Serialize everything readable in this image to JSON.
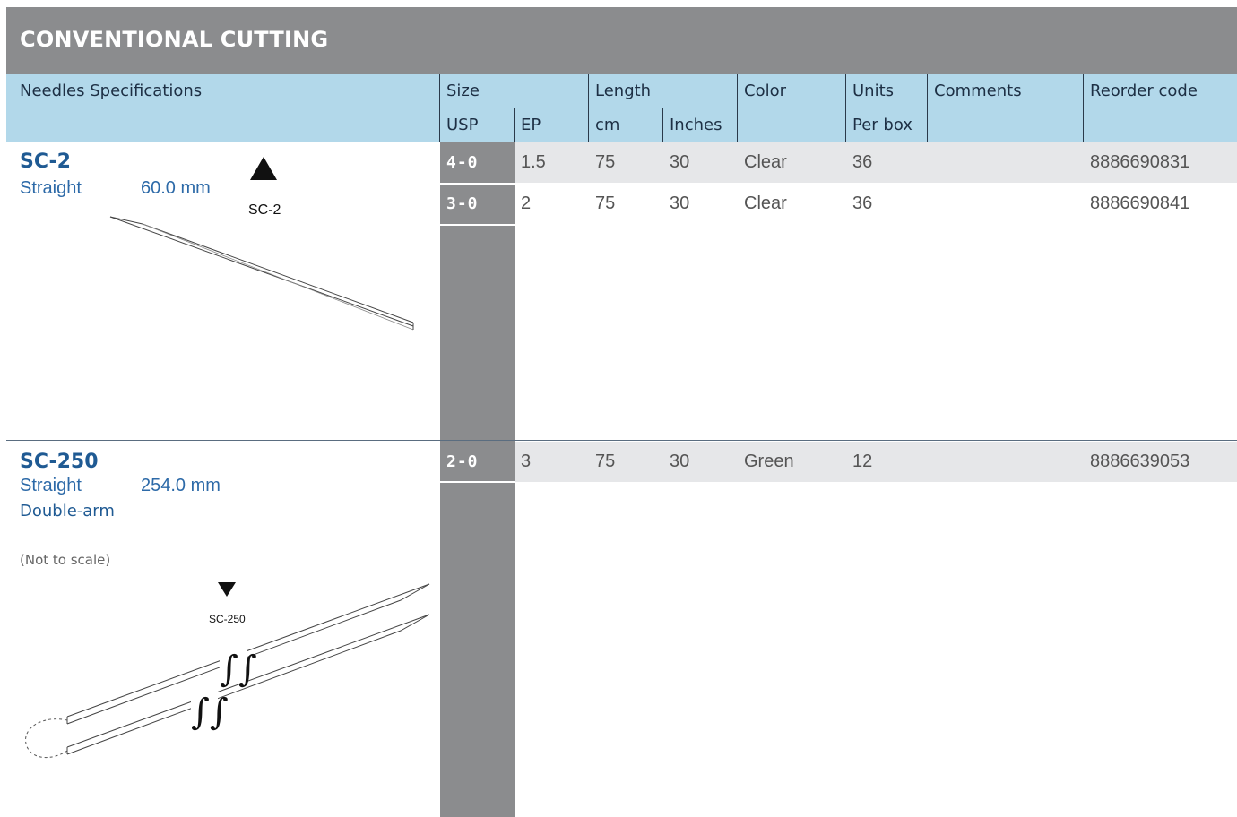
{
  "title": "CONVENTIONAL CUTTING",
  "header": {
    "needles_specs": "Needles Specifications",
    "size": "Size",
    "usp": "USP",
    "ep": "EP",
    "length": "Length",
    "cm": "cm",
    "inches": "Inches",
    "color": "Color",
    "units": "Units",
    "per_box": "Per box",
    "comments": "Comments",
    "reorder_code": "Reorder code"
  },
  "needles": [
    {
      "name": "SC-2",
      "shape": "Straight",
      "length": "60.0 mm",
      "extra": "",
      "note": "",
      "label": "SC-2",
      "rows": [
        {
          "usp": "4-0",
          "ep": "1.5",
          "cm": "75",
          "inches": "30",
          "color": "Clear",
          "units": "36",
          "comments": "",
          "code": "8886690831"
        },
        {
          "usp": "3-0",
          "ep": "2",
          "cm": "75",
          "inches": "30",
          "color": "Clear",
          "units": "36",
          "comments": "",
          "code": "8886690841"
        }
      ]
    },
    {
      "name": "SC-250",
      "shape": "Straight",
      "length": "254.0 mm",
      "extra": "Double-arm",
      "note": "(Not to scale)",
      "label": "SC-250",
      "rows": [
        {
          "usp": "2-0",
          "ep": "3",
          "cm": "75",
          "inches": "30",
          "color": "Green",
          "units": "12",
          "comments": "",
          "code": "8886639053"
        }
      ]
    }
  ],
  "colors": {
    "title_bar": "#8b8c8e",
    "header": "#b2d8ea",
    "band": "#e6e7e9",
    "name_blue": "#1f5a93"
  },
  "icons": [
    "triangle-up-icon",
    "triangle-down-icon",
    "needle-straight-icon",
    "needle-double-arm-icon",
    "break-mark-icon"
  ]
}
